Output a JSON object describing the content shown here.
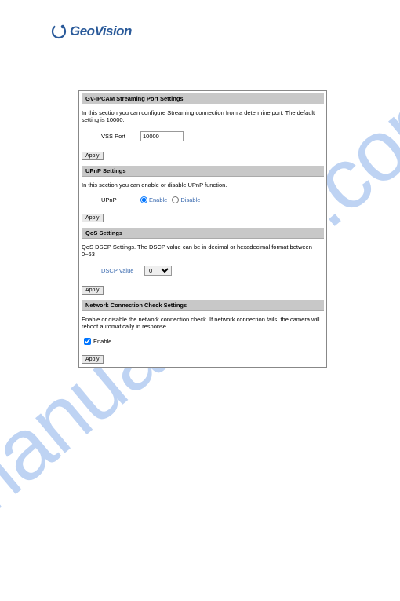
{
  "logo": {
    "text": "GeoVision"
  },
  "watermark": "manualshive.com",
  "sections": {
    "streaming": {
      "header": "GV-IPCAM Streaming Port Settings",
      "desc": "In this section you can configure Streaming connection from a determine port. The default setting is 10000.",
      "vss_label": "VSS Port",
      "vss_value": "10000",
      "apply": "Apply"
    },
    "upnp": {
      "header": "UPnP Settings",
      "desc": "In this section you can enable or disable UPnP function.",
      "label": "UPnP",
      "enable_label": "Enable",
      "disable_label": "Disable",
      "apply": "Apply"
    },
    "qos": {
      "header": "QoS Settings",
      "desc": "QoS DSCP Settings. The DSCP value can be in decimal or hexadecimal format between 0~63",
      "dscp_label": "DSCP Value",
      "dscp_value": "0",
      "apply": "Apply"
    },
    "netcheck": {
      "header": "Network Connection Check Settings",
      "desc": "Enable or disable the network connection check. If network connection fails, the camera will reboot automatically in response.",
      "enable_label": "Enable",
      "apply": "Apply"
    }
  }
}
